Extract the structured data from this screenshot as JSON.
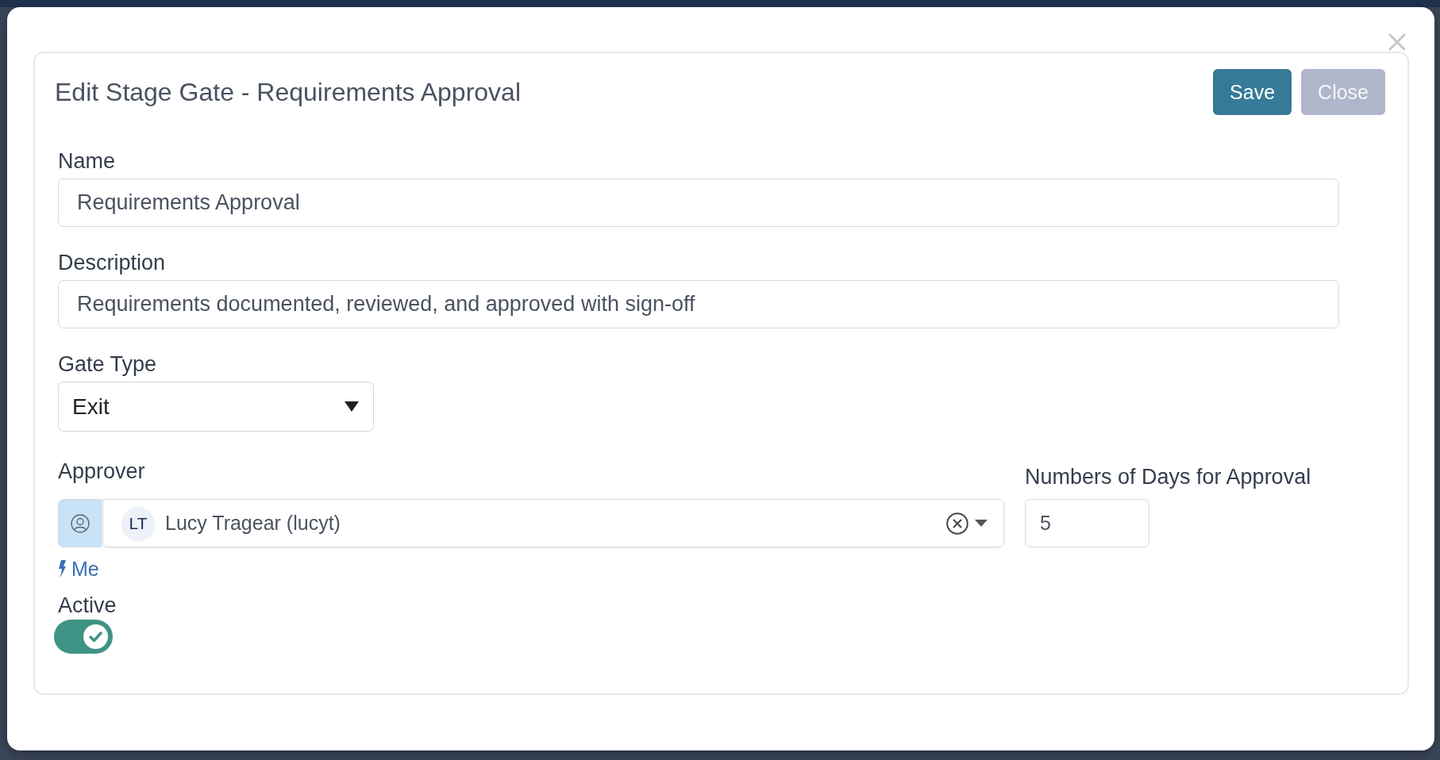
{
  "dialog": {
    "title": "Edit Stage Gate - Requirements Approval",
    "buttons": [
      {
        "label": "Save",
        "kind": "primary"
      },
      {
        "label": "Close",
        "kind": "secondary"
      }
    ]
  },
  "form": {
    "name": {
      "label": "Name",
      "value": "Requirements Approval"
    },
    "description": {
      "label": "Description",
      "value": "Requirements documented, reviewed, and approved with sign-off"
    },
    "gate_type": {
      "label": "Gate Type",
      "value": "Exit"
    },
    "approver": {
      "label": "Approver",
      "initials": "LT",
      "value": "Lucy Tragear (lucyt)",
      "shortcut": "Me"
    },
    "days_for_approval": {
      "label": "Numbers of Days for Approval",
      "value": "5"
    },
    "active": {
      "label": "Active",
      "on": true
    }
  }
}
